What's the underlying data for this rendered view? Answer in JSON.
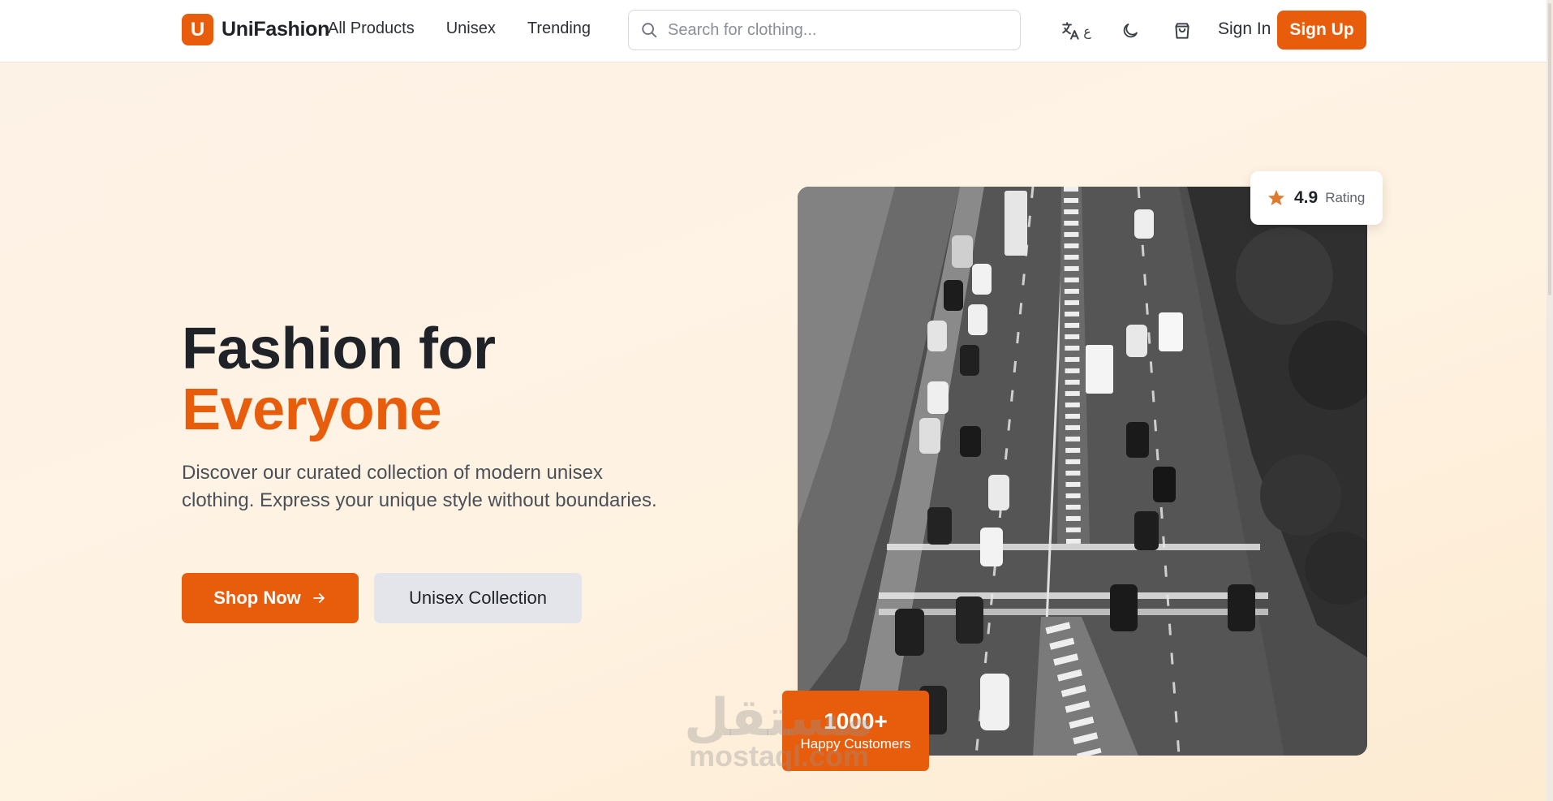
{
  "header": {
    "brand_letter": "U",
    "brand_name": "UniFashion",
    "nav": [
      "All Products",
      "Unisex",
      "Trending"
    ],
    "search_placeholder": "Search for clothing...",
    "lang_glyph": "ع",
    "sign_in": "Sign In",
    "sign_up": "Sign Up"
  },
  "hero": {
    "title_line1": "Fashion for",
    "title_line2": "Everyone",
    "description": "Discover our curated collection of modern unisex clothing. Express your unique style without boundaries.",
    "primary_button": "Shop Now",
    "secondary_button": "Unisex Collection"
  },
  "rating": {
    "value": "4.9",
    "label": "Rating"
  },
  "customers": {
    "value": "1000+",
    "label": "Happy Customers"
  },
  "watermark": {
    "arabic": "مستقل",
    "latin": "mostaql.com"
  },
  "colors": {
    "accent": "#e85d0c",
    "background": "#fef3e3"
  }
}
